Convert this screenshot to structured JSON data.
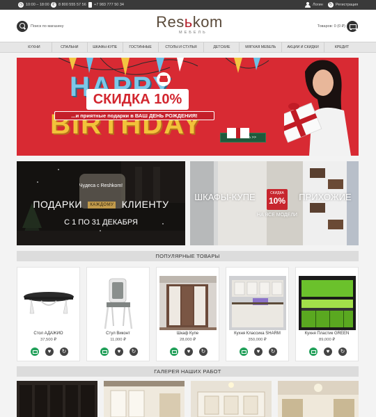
{
  "topbar": {
    "hours": "10:00 – 18:00",
    "phone1": "8 800 555 57 56",
    "phone2": "+7 983 777 50 34",
    "login": "Логин",
    "register": "Регистрация"
  },
  "header": {
    "search_label": "Поиск по магазину",
    "logo_main": "Res",
    "logo_accent": "ь",
    "logo_end": "kom",
    "logo_sub": "МЕБЕЛЬ",
    "cart_label": "Товаров: 0 (0 ₽)"
  },
  "nav": {
    "items": [
      "КУХНИ",
      "СПАЛЬНИ",
      "ШКАФЫ-КУПЕ",
      "ГОСТИННЫЕ",
      "СТОЛЫ И СТУЛЬЯ",
      "ДЕТСКИЕ",
      "МЯГКАЯ МЕБЕЛЬ",
      "АКЦИИ И СКИДКИ",
      "КРЕДИТ"
    ]
  },
  "banner": {
    "happy": "HAPPY",
    "birthday": "BIRTHDAY",
    "discount": "СКИДКА 10%",
    "gifts": "...и приятные подарки в ВАШ ДЕНЬ РОЖДЕНИЯ!",
    "button": "ПОЛУЧИТЬ >>"
  },
  "promo_left": {
    "line1": "Чудеса с Reshkom!",
    "line2a": "ПОДАРКИ",
    "line2b": "КАЖДОМУ",
    "line2c": "КЛИЕНТУ",
    "line3": "С 1 ПО 31 ДЕКАБРЯ"
  },
  "promo_right": {
    "left_word": "ШКАФЫ-КУПЕ",
    "badge_top": "СКИДКА",
    "badge_value": "10%",
    "right_word": "ПРИХОЖИЕ",
    "subtitle": "НА ВСЕ МОДЕЛИ"
  },
  "popular": {
    "title": "ПОПУЛЯРНЫЕ ТОВАРЫ",
    "products": [
      {
        "name": "Стол АДАЖИО",
        "price": "37,500 ₽"
      },
      {
        "name": "Стул Виконт",
        "price": "11,000 ₽"
      },
      {
        "name": "Шкаф Купе",
        "price": "28,000 ₽"
      },
      {
        "name": "Кухня Классика SHARM",
        "price": "350,000 ₽"
      },
      {
        "name": "Кухня Пластик GREEN",
        "price": "89,000 ₽"
      }
    ]
  },
  "gallery": {
    "title": "ГАЛЕРЕЯ НАШИХ РАБОТ"
  },
  "colors": {
    "accent_green": "#22a05a",
    "banner_red": "#d82a33",
    "logo_red": "#b41f2a",
    "dark": "#333333"
  }
}
